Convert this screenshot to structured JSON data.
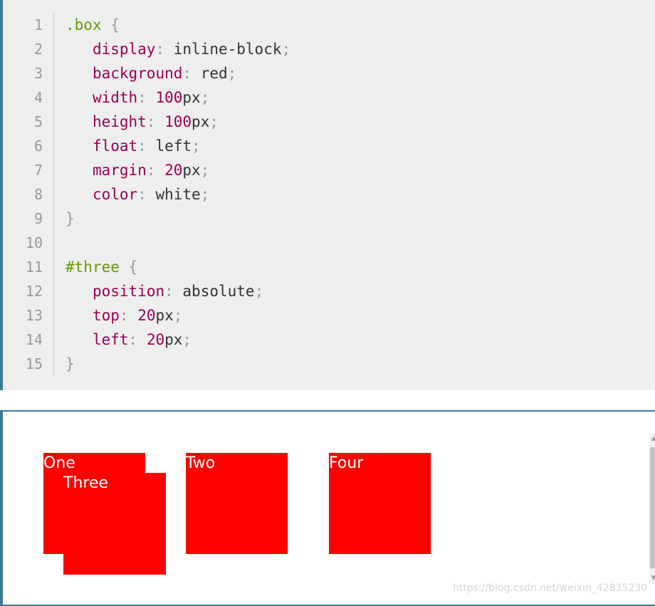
{
  "code": {
    "lines": [
      {
        "n": "1",
        "selector": ".box",
        "brace": "{"
      },
      {
        "n": "2",
        "prop": "display",
        "colon": ":",
        "val": "inline-block",
        "semi": ";"
      },
      {
        "n": "3",
        "prop": "background",
        "colon": ":",
        "val": "red",
        "semi": ";"
      },
      {
        "n": "4",
        "prop": "width",
        "colon": ":",
        "num": "100",
        "unit": "px",
        "semi": ";"
      },
      {
        "n": "5",
        "prop": "height",
        "colon": ":",
        "num": "100",
        "unit": "px",
        "semi": ";"
      },
      {
        "n": "6",
        "prop": "float",
        "colon": ":",
        "val": "left",
        "semi": ";"
      },
      {
        "n": "7",
        "prop": "margin",
        "colon": ":",
        "num": "20",
        "unit": "px",
        "semi": ";"
      },
      {
        "n": "8",
        "prop": "color",
        "colon": ":",
        "val": "white",
        "semi": ";"
      },
      {
        "n": "9",
        "brace": "}"
      },
      {
        "n": "10"
      },
      {
        "n": "11",
        "selector": "#three",
        "brace": "{"
      },
      {
        "n": "12",
        "prop": "position",
        "colon": ":",
        "val": "absolute",
        "semi": ";"
      },
      {
        "n": "13",
        "prop": "top",
        "colon": ":",
        "num": "20",
        "unit": "px",
        "semi": ";"
      },
      {
        "n": "14",
        "prop": "left",
        "colon": ":",
        "num": "20",
        "unit": "px",
        "semi": ";"
      },
      {
        "n": "15",
        "brace": "}"
      }
    ]
  },
  "preview": {
    "boxes": {
      "one": "One",
      "two": "Two",
      "three": "Three",
      "four": "Four"
    },
    "box_color": "#ff0000",
    "text_color": "#ffffff"
  },
  "watermark": "https://blog.csdn.net/weixin_42835230",
  "colors": {
    "border_accent": "#3d7a94",
    "selector": "#669900",
    "property": "#990055",
    "punctuation": "#999999"
  }
}
